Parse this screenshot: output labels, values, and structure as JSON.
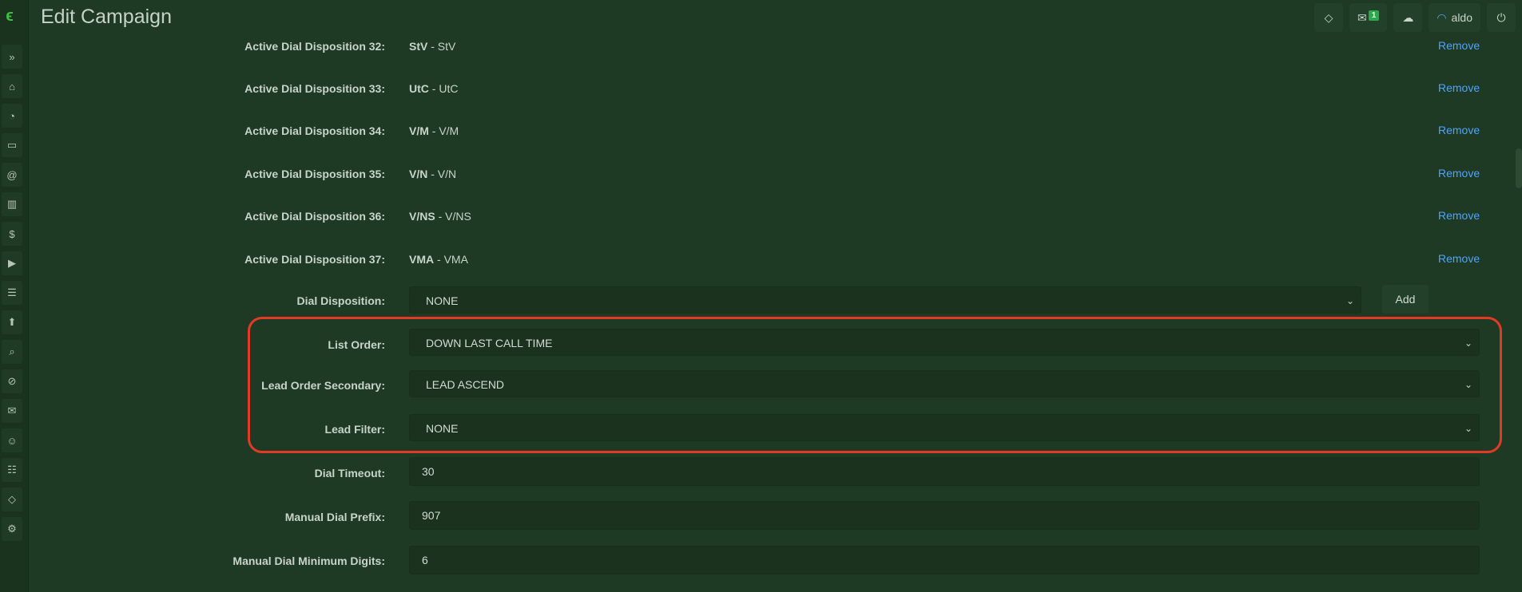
{
  "header": {
    "title": "Edit Campaign",
    "mail_count": "1",
    "user_name": "aldo"
  },
  "sidebar": {
    "icons": [
      "expand-icon",
      "home-icon",
      "dashboard-icon",
      "monitor-icon",
      "at-icon",
      "chart-icon",
      "dollar-icon",
      "play-icon",
      "list-icon",
      "upload-icon",
      "search-icon",
      "ban-icon",
      "mail-icon",
      "users-icon",
      "sliders-icon",
      "tag-icon",
      "gear-icon"
    ]
  },
  "dispositions": [
    {
      "label": "Active Dial Disposition 32:",
      "code": "StV",
      "name": " - StV",
      "remove": "Remove"
    },
    {
      "label": "Active Dial Disposition 33:",
      "code": "UtC",
      "name": " - UtC",
      "remove": "Remove"
    },
    {
      "label": "Active Dial Disposition 34:",
      "code": "V/M",
      "name": " - V/M",
      "remove": "Remove"
    },
    {
      "label": "Active Dial Disposition 35:",
      "code": "V/N",
      "name": " - V/N",
      "remove": "Remove"
    },
    {
      "label": "Active Dial Disposition 36:",
      "code": "V/NS",
      "name": " - V/NS",
      "remove": "Remove"
    },
    {
      "label": "Active Dial Disposition 37:",
      "code": "VMA",
      "name": " - VMA",
      "remove": "Remove"
    }
  ],
  "dial_disposition": {
    "label": "Dial Disposition:",
    "value": "NONE",
    "add_label": "Add"
  },
  "list_order": {
    "label": "List Order:",
    "value": "DOWN LAST CALL TIME"
  },
  "lead_order_secondary": {
    "label": "Lead Order Secondary:",
    "value": "LEAD ASCEND"
  },
  "lead_filter": {
    "label": "Lead Filter:",
    "value": "NONE"
  },
  "dial_timeout": {
    "label": "Dial Timeout:",
    "value": "30"
  },
  "manual_dial_prefix": {
    "label": "Manual Dial Prefix:",
    "value": "907"
  },
  "manual_dial_min_digits": {
    "label": "Manual Dial Minimum Digits:",
    "value": "6"
  },
  "colors": {
    "background": "#1e3a24",
    "link": "#4ea3ff",
    "highlight": "#e23a25",
    "badge": "#2aa84a"
  }
}
